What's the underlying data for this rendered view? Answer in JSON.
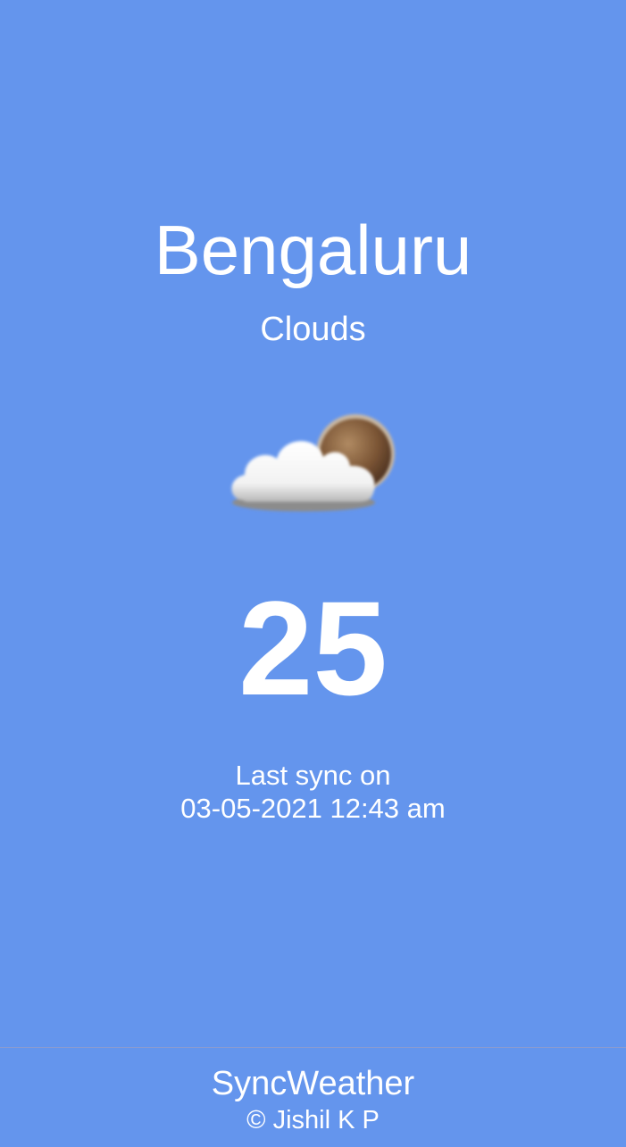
{
  "weather": {
    "city": "Bengaluru",
    "condition": "Clouds",
    "icon": "cloud-with-sun-icon",
    "temperature": "25",
    "sync_label": "Last sync on",
    "sync_time": "03-05-2021 12:43 am"
  },
  "footer": {
    "brand": "SyncWeather",
    "copyright": "© Jishil K P"
  },
  "colors": {
    "background": "#6495ED",
    "text": "#ffffff"
  }
}
